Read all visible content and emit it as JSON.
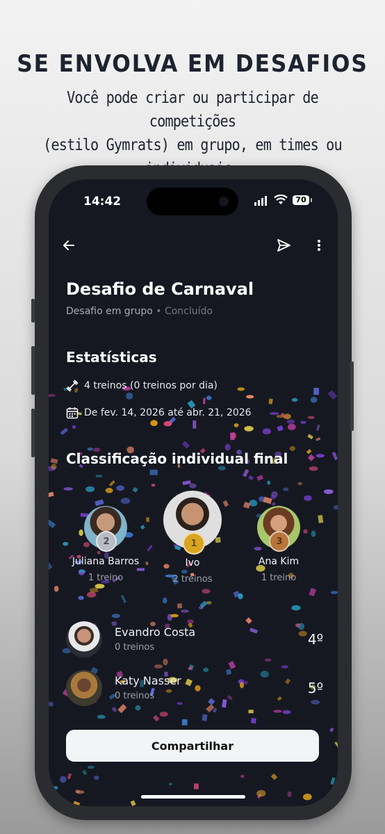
{
  "promo": {
    "headline": "SE ENVOLVA EM DESAFIOS",
    "subline_1": "Você pode criar ou participar de competições",
    "subline_2": "(estilo Gymrats) em grupo, em times ou individuais."
  },
  "status_bar": {
    "time": "14:42",
    "battery": "70"
  },
  "header": {
    "back_icon": "arrow-left-icon",
    "share_icon": "send-icon",
    "menu_icon": "more-vertical-icon"
  },
  "challenge": {
    "title": "Desafio de Carnaval",
    "type": "Desafio em grupo",
    "separator": " • ",
    "status": "Concluído"
  },
  "stats": {
    "heading": "Estatísticas",
    "workouts": "4 treinos (0 treinos por dia)",
    "dates": "De fev. 14, 2026 até abr. 21, 2026"
  },
  "ranking": {
    "heading": "Classificação individual final",
    "podium": [
      {
        "name": "Juliana Barros",
        "count": "1 treino",
        "medal": "2",
        "medal_color": "#b9bcc3"
      },
      {
        "name": "Ivo",
        "count": "2 treinos",
        "medal": "1",
        "medal_color": "#d9a520"
      },
      {
        "name": "Ana Kim",
        "count": "1 treino",
        "medal": "3",
        "medal_color": "#b8763c"
      }
    ],
    "rows": [
      {
        "name": "Evandro Costa",
        "count": "0 treinos",
        "position": "4º"
      },
      {
        "name": "Katy Nasser",
        "count": "0 treinos",
        "position": "5º"
      }
    ]
  },
  "share_button": "Compartilhar",
  "colors": {
    "background": "#151821",
    "text": "#ffffff",
    "muted": "#9ca0ab",
    "button_bg": "#f3f4f6"
  }
}
